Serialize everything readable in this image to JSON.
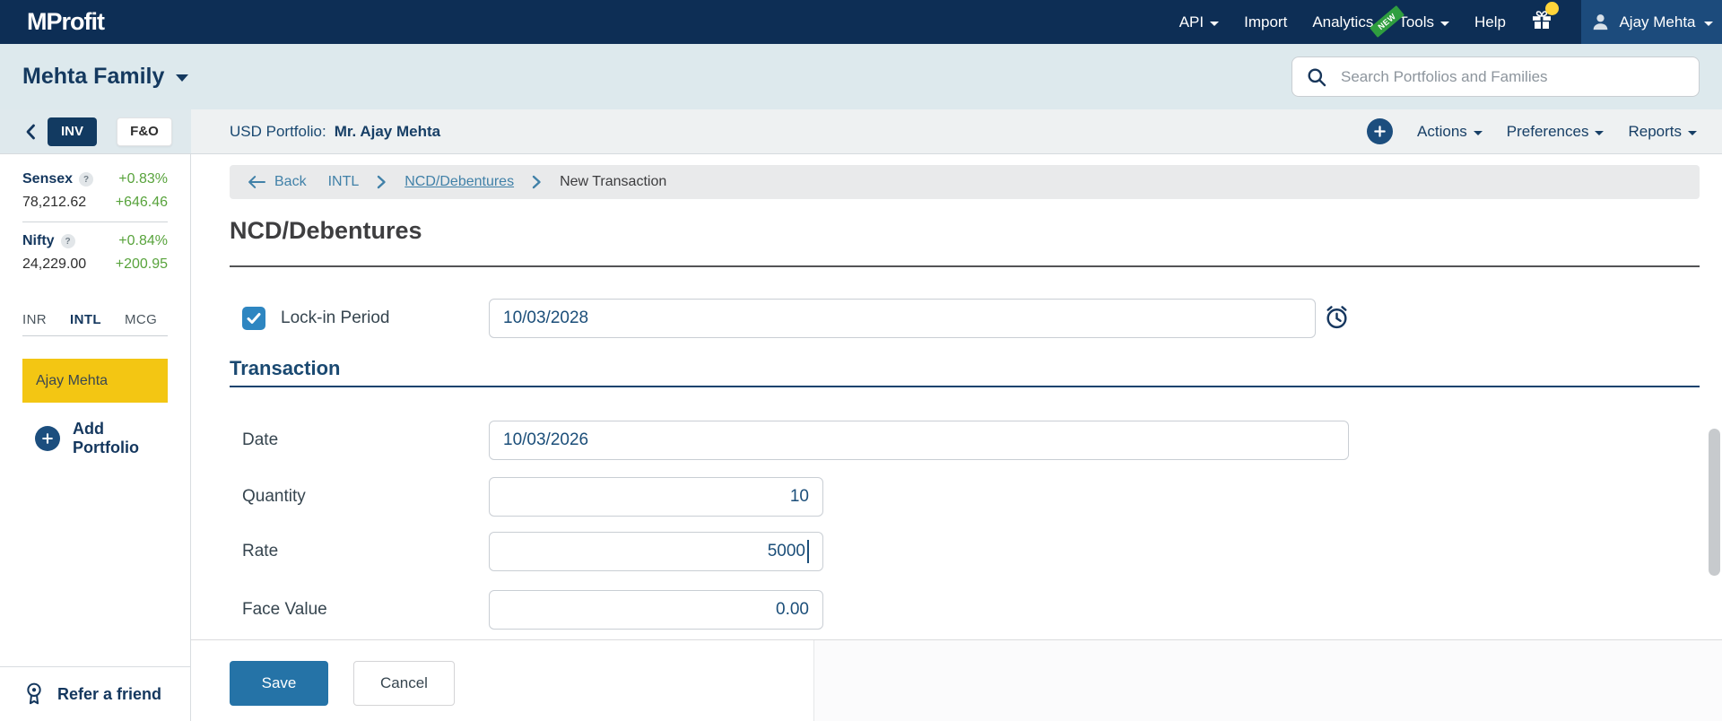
{
  "brand": {
    "logo_text": "MProfit"
  },
  "topnav": {
    "api": "API",
    "import": "Import",
    "analytics": "Analytics",
    "analytics_badge": "NEW",
    "tools": "Tools",
    "help": "Help",
    "user_name": "Ajay Mehta"
  },
  "family_bar": {
    "family_name": "Mehta Family",
    "search_placeholder": "Search Portfolios and Families"
  },
  "portfolio_bar": {
    "portfolio_label": "USD Portfolio:",
    "portfolio_name": "Mr. Ajay Mehta",
    "actions": "Actions",
    "preferences": "Preferences",
    "reports": "Reports"
  },
  "sidebar": {
    "inv_tab": "INV",
    "fo_tab": "F&O",
    "help_badge": "?",
    "indices": [
      {
        "name": "Sensex",
        "value": "78,212.62",
        "change_pct": "+0.83%",
        "change_abs": "+646.46"
      },
      {
        "name": "Nifty",
        "value": "24,229.00",
        "change_pct": "+0.84%",
        "change_abs": "+200.95"
      }
    ],
    "currency_tabs": [
      "INR",
      "INTL",
      "MCG"
    ],
    "active_currency_tab": "INTL",
    "portfolio_item": "Ajay Mehta",
    "add_portfolio_label": "Add Portfolio",
    "refer_label": "Refer a friend"
  },
  "breadcrumb": {
    "back_label": "Back",
    "level1": "INTL",
    "level2": "NCD/Debentures",
    "level3": "New Transaction"
  },
  "form": {
    "page_title": "NCD/Debentures",
    "lock_in_label": "Lock-in Period",
    "lock_in_checked": true,
    "lock_in_value": "10/03/2028",
    "section_title": "Transaction",
    "date_label": "Date",
    "date_value": "10/03/2026",
    "quantity_label": "Quantity",
    "quantity_value": "10",
    "rate_label": "Rate",
    "rate_value": "5000",
    "face_value_label": "Face Value",
    "face_value_value": "0.00",
    "save_label": "Save",
    "cancel_label": "Cancel"
  },
  "colors": {
    "navbar_navy": "#0d2e55",
    "user_section_blue": "#1c4b7c",
    "bar_bluegray": "#dde9ed",
    "link_blue": "#4181a8",
    "heading_navy": "#1a4971",
    "positive_green": "#58a33c",
    "highlight_yellow": "#f3c613",
    "checkbox_blue": "#2e86c1",
    "save_blue": "#2573a7",
    "badge_green": "#2f9e3f",
    "notification_yellow": "#ffd43a"
  }
}
